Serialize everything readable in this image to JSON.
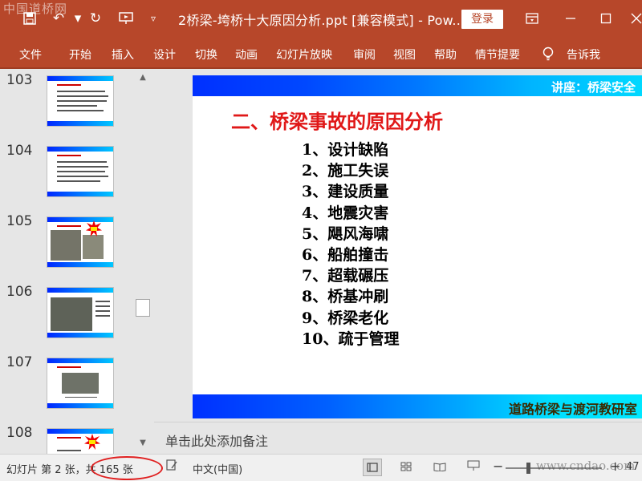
{
  "titlebar": {
    "document_title": "2桥梁-垮桥十大原因分析.ppt [兼容模式] - Pow...",
    "login_label": "登录",
    "watermark": "中国道桥网"
  },
  "ribbon": {
    "tabs": [
      "文件",
      "开始",
      "插入",
      "设计",
      "切换",
      "动画",
      "幻灯片放映",
      "审阅",
      "视图",
      "帮助",
      "情节提要",
      "告诉我"
    ]
  },
  "thumbnails": {
    "slides": [
      {
        "number": "103"
      },
      {
        "number": "104"
      },
      {
        "number": "105"
      },
      {
        "number": "106"
      },
      {
        "number": "107"
      },
      {
        "number": "108"
      }
    ]
  },
  "slide": {
    "header_text": "讲座：桥梁安全",
    "title": "二、桥梁事故的原因分析",
    "items": [
      "1、设计缺陷",
      "2、施工失误",
      "3、建设质量",
      "4、地震灾害",
      "5、飓风海啸",
      "6、船舶撞击",
      "7、超载碾压",
      "8、桥基冲刷",
      "9、桥梁老化",
      "10、疏于管理"
    ],
    "footer_text": "道路桥梁与渡河教研室"
  },
  "notes": {
    "placeholder": "单击此处添加备注"
  },
  "status": {
    "slide_position": "幻灯片 第 2 张，共 165 张",
    "language": "中文(中国)",
    "zoom": "47",
    "watermark": "www.cndao.com"
  }
}
